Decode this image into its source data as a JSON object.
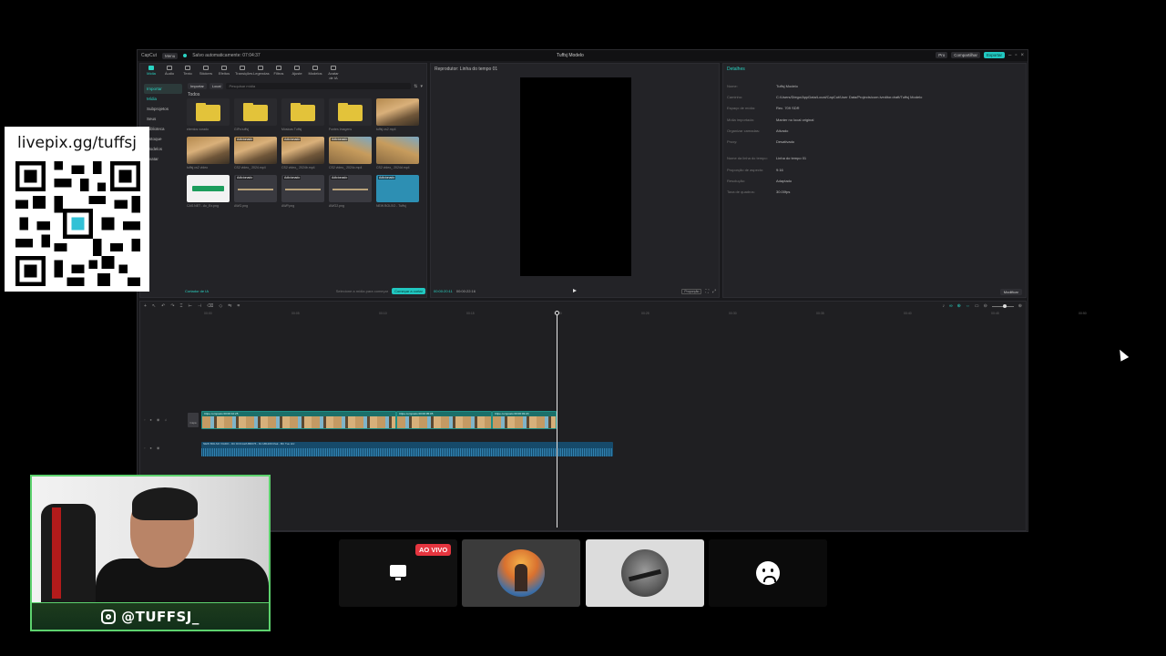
{
  "window": {
    "app_name": "CapCut",
    "menu_label": "Menu",
    "autosave": "Salvo automaticamente: 07:04:37",
    "title": "Tuffsj Modelo",
    "pro_label": "Pro",
    "share_label": "Compartilhar",
    "export_label": "Exportar"
  },
  "media": {
    "tabs": [
      "Mídia",
      "Áudio",
      "Texto",
      "Stickers",
      "Efeitos",
      "Transições",
      "Legendas",
      "Filtros",
      "Ajuste",
      "Modelos",
      "Avatar de IA"
    ],
    "side_nav": [
      "Importar",
      "Mídia",
      "Subprojetos",
      "Seus",
      "Biblioteca",
      "Estoque",
      "Modelos",
      "Avatar"
    ],
    "import_label": "Importar",
    "local_label": "Local",
    "search_placeholder": "Pesquisar mídia",
    "section_all": "Todos",
    "items": [
      {
        "kind": "folder",
        "name": "elemtos vorado",
        "added": ""
      },
      {
        "kind": "folder",
        "name": "GIFs tuffsj",
        "added": ""
      },
      {
        "kind": "folder",
        "name": "Músicas Tuffsj",
        "added": ""
      },
      {
        "kind": "folder",
        "name": "Fontes Imagens",
        "added": ""
      },
      {
        "kind": "game",
        "name": "tuffsj cs2.mp4",
        "added": ""
      },
      {
        "kind": "game",
        "name": "tuffsj cs2 video",
        "added": ""
      },
      {
        "kind": "game",
        "name": "CS2 video_ 2024.mp4",
        "added": "Adicionado"
      },
      {
        "kind": "game",
        "name": "CS2 video_ 2024b.mp4",
        "added": "Adicionado"
      },
      {
        "kind": "game2",
        "name": "CS2 video_ 2024c.mp4",
        "added": "Adicionado"
      },
      {
        "kind": "game2",
        "name": "CS2 video_ 2024d.mp4",
        "added": ""
      },
      {
        "kind": "logo",
        "name": "CAS.NET - Av_Ex.png",
        "added": ""
      },
      {
        "kind": "dark",
        "name": "AWG.png",
        "added": "Adicionado"
      },
      {
        "kind": "dark",
        "name": "AWP.png",
        "added": "Adicionado"
      },
      {
        "kind": "dark",
        "name": "AWG2.png",
        "added": "Adicionado"
      },
      {
        "kind": "blue",
        "name": "NEW BOLSO - Tuffsj",
        "added": "Adicionado"
      }
    ],
    "ai_label": "Cortador de IA",
    "ai_hint": "Selecione a mídia para começar",
    "ai_button": "Começar a cortar"
  },
  "player": {
    "title": "Reprodutor: Linha do tempo 01",
    "time_current": "00:00:20:11",
    "time_total": "00:00:22:16",
    "ratio_label": "Proporção"
  },
  "details": {
    "tab": "Detalhes",
    "rows": [
      {
        "key": "Nome:",
        "value": "Tuffsj Modelo"
      },
      {
        "key": "Caminho:",
        "value": "C:/Users/Diego/AppData/Local/CapCut/User Data/Projects/com.lveditor.draft/Tuffsj Modelo"
      },
      {
        "key": "Espaço de mídia:",
        "value": "Rec. 709 SDR"
      },
      {
        "key": "Mídia importada:",
        "value": "Manter no local original"
      },
      {
        "key": "Organizar camadas:",
        "value": "Ativado"
      },
      {
        "key": "Proxy:",
        "value": "Desativado"
      },
      {
        "key": "Nome da linha do tempo:",
        "value": "Linha do tempo 01"
      },
      {
        "key": "Proporção de aspecto:",
        "value": "9:16"
      },
      {
        "key": "Resolução:",
        "value": "Adaptado"
      },
      {
        "key": "Taxa de quadros:",
        "value": "30.00fps"
      }
    ],
    "modify_button": "Modificar"
  },
  "timeline": {
    "ticks": [
      "00:00",
      "00:05",
      "00:10",
      "00:15",
      "00:20",
      "00:25",
      "00:30",
      "00:35",
      "00:40",
      "00:45",
      "00:50"
    ],
    "cover_label": "Capa",
    "clips": [
      {
        "label": "Clipe composto  00:00:10:25",
        "width": 214
      },
      {
        "label": "Clipe composto  00:00:05:05",
        "width": 105
      },
      {
        "label": "Clipe composto  00:00:03:20",
        "width": 71
      }
    ],
    "audio_label": "NEW BOLSO VIADO - DC DOCA2A BR076 - Dc kB1209 Rwk - BC Tuu Hrz"
  },
  "overlay": {
    "donation_url": "livepix.gg/tuffsj",
    "instagram_handle": "@TUFFSJ_",
    "live_badge": "AO VIVO"
  },
  "colors": {
    "accent": "#21c7c0",
    "live_red": "#e5353f",
    "cam_border": "#5dd26e"
  }
}
